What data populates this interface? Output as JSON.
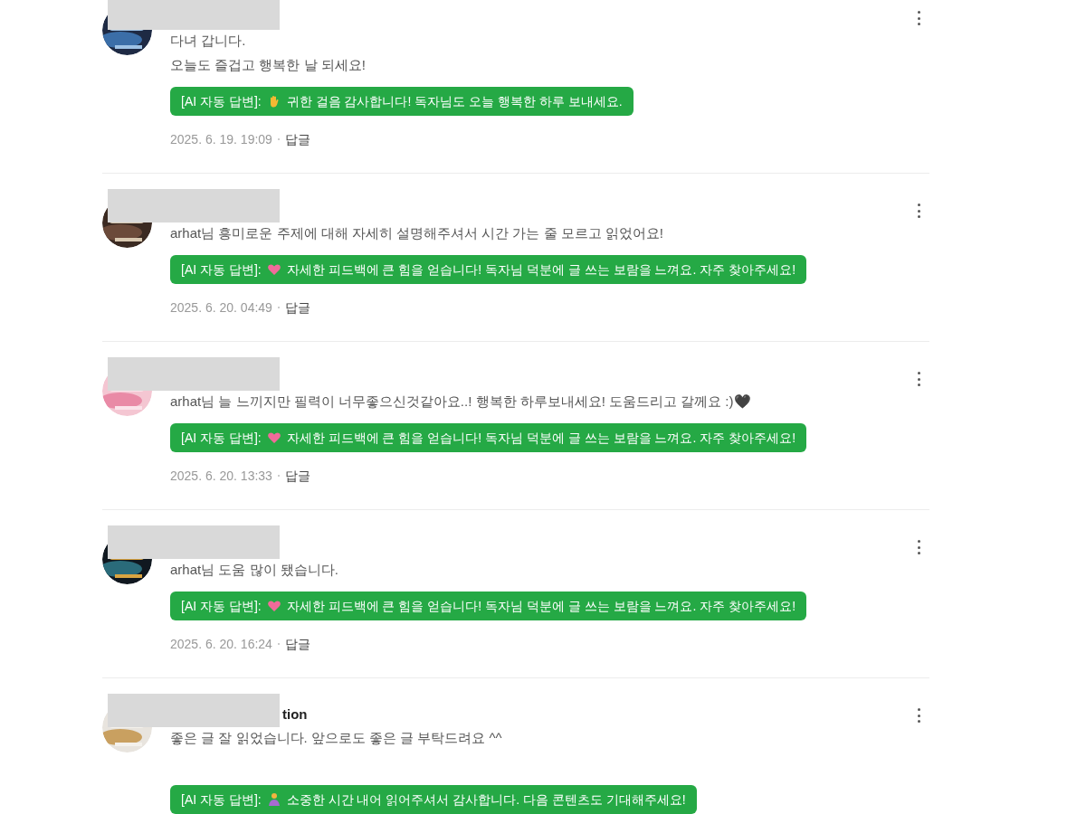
{
  "comments": [
    {
      "body": [
        "다녀 갑니다.",
        "오늘도 즐겁고 행복한 날 되세요!"
      ],
      "reply": {
        "label": "[AI 자동 답변]:",
        "kind": "wave",
        "text": "귀한 걸음 감사합니다! 독자님도 오늘 행복한 하루 보내세요."
      },
      "date": "2025. 6. 19. 19:09",
      "reply_link": "답글"
    },
    {
      "body": [
        "arhat님 흥미로운 주제에 대해 자세히 설명해주셔서 시간 가는 줄 모르고 읽었어요!"
      ],
      "reply": {
        "label": "[AI 자동 답변]:",
        "kind": "heart",
        "text": "자세한 피드백에 큰 힘을 얻습니다! 독자님 덕분에 글 쓰는 보람을 느껴요. 자주 찾아주세요!"
      },
      "date": "2025. 6. 20. 04:49",
      "reply_link": "답글"
    },
    {
      "body": [
        "arhat님 늘 느끼지만 필력이 너무좋으신것같아요..! 행복한 하루보내세요! 도움드리고 갈께요 :)🖤"
      ],
      "reply": {
        "label": "[AI 자동 답변]:",
        "kind": "heart",
        "text": "자세한 피드백에 큰 힘을 얻습니다! 독자님 덕분에 글 쓰는 보람을 느껴요. 자주 찾아주세요!"
      },
      "date": "2025. 6. 20. 13:33",
      "reply_link": "답글"
    },
    {
      "body": [
        "arhat님 도움 많이 됐습니다."
      ],
      "reply": {
        "label": "[AI 자동 답변]:",
        "kind": "heart",
        "text": "자세한 피드백에 큰 힘을 얻습니다! 독자님 덕분에 글 쓰는 보람을 느껴요. 자주 찾아주세요!"
      },
      "date": "2025. 6. 20. 16:24",
      "reply_link": "답글"
    },
    {
      "name": "tion",
      "body": [
        "좋은 글 잘 읽었습니다. 앞으로도 좋은 글 부탁드려요 ^^"
      ],
      "spaced": true,
      "reply": {
        "label": "[AI 자동 답변]:",
        "kind": "pray",
        "text": "소중한 시간 내어 읽어주셔서 감사합니다. 다음 콘텐츠도 기대해주세요!"
      }
    }
  ]
}
